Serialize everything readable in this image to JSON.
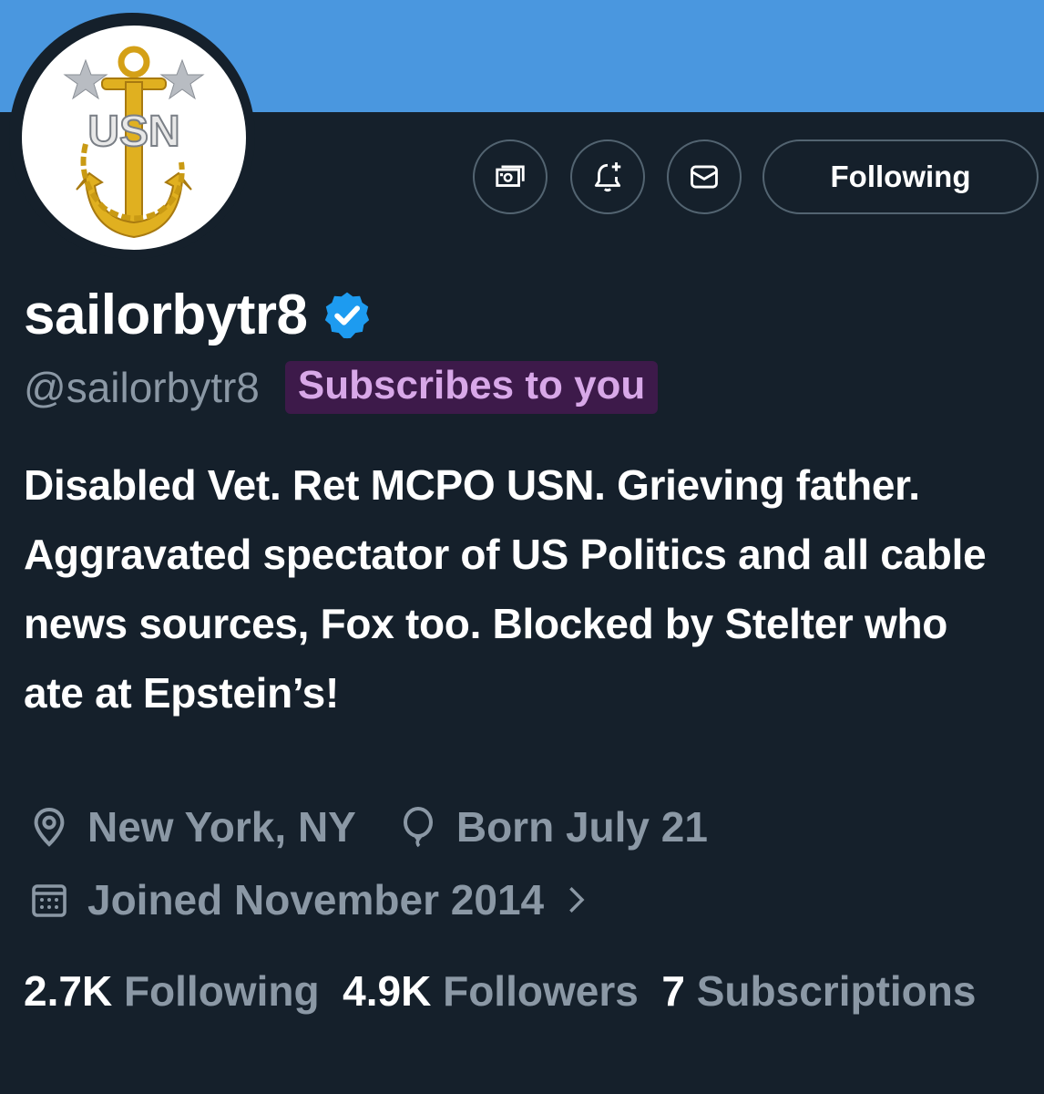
{
  "profile": {
    "display_name": "sailorbytr8",
    "handle": "@sailorbytr8",
    "subscribes_badge": "Subscribes to you",
    "bio": "Disabled Vet. Ret MCPO USN. Grieving father. Aggravated spectator of US Politics and all cable news sources, Fox too. Blocked by Stelter who ate at Epstein’s!",
    "location": "New York, NY",
    "birthday": "Born July 21",
    "joined": "Joined November 2014",
    "avatar_text": "USN"
  },
  "actions": {
    "tips_icon": "money-icon",
    "notify_icon": "bell-plus-icon",
    "message_icon": "envelope-icon",
    "follow_label": "Following"
  },
  "stats": {
    "following_count": "2.7K",
    "following_label": "Following",
    "followers_count": "4.9K",
    "followers_label": "Followers",
    "subscriptions_count": "7",
    "subscriptions_label": "Subscriptions"
  },
  "colors": {
    "background": "#15202b",
    "banner": "#4a97df",
    "muted_text": "#8b98a5",
    "verified": "#1d9bf0",
    "badge_bg": "#3d1a4a",
    "badge_text": "#d8a8e8"
  }
}
